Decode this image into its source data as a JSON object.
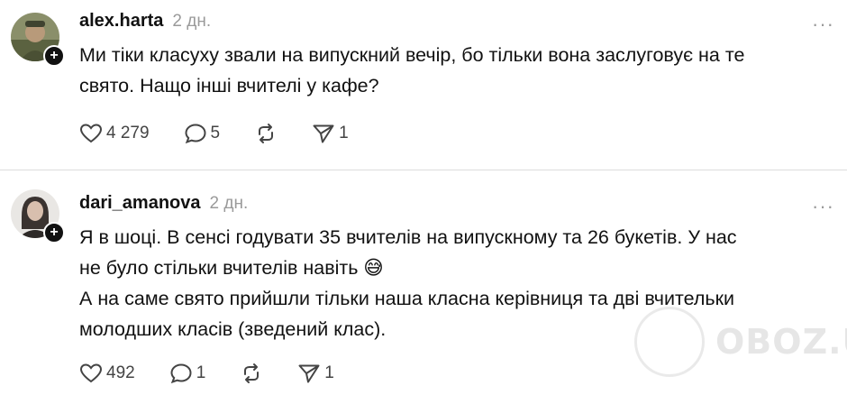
{
  "colors": {
    "text": "#111111",
    "muted": "#9a9a9a",
    "divider": "#dcdcdc",
    "badge": "#111111"
  },
  "posts": [
    {
      "username": "alex.harta",
      "time": "2 дн.",
      "more": "···",
      "lines": [
        "Ми тіки класуху звали на випускний вечір, бо тільки вона заслуговує на те",
        "свято. Нащо інші вчителі у кафе?"
      ],
      "likes": "4 279",
      "comments": "5",
      "reposts": "",
      "shares": "1"
    },
    {
      "username": "dari_amanova",
      "time": "2 дн.",
      "more": "···",
      "lines": [
        "Я в шоці. В сенсі годувати 35 вчителів на випускному та 26 букетів. У нас",
        "не було стільки вчителів навіть 😅",
        "А на саме свято прийшли тільки наша класна керівниця та дві вчительки",
        "молодших класів (зведений клас)."
      ],
      "likes": "492",
      "comments": "1",
      "reposts": "",
      "shares": "1"
    }
  ],
  "watermark": {
    "text": "OBOZ.UA"
  }
}
